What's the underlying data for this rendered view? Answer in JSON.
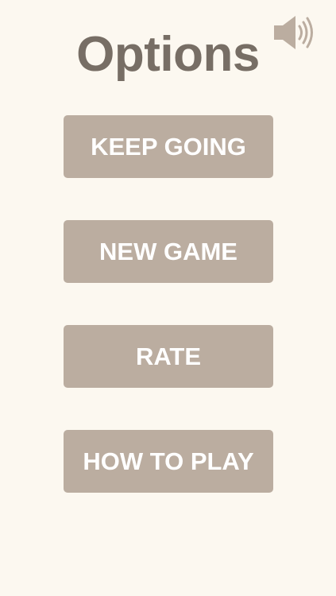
{
  "page": {
    "title": "Options"
  },
  "sound_toggle": {
    "icon": "speaker-volume-icon",
    "state": "on"
  },
  "menu": {
    "items": [
      {
        "label": "KEEP GOING"
      },
      {
        "label": "NEW GAME"
      },
      {
        "label": "RATE"
      },
      {
        "label": "HOW TO PLAY"
      }
    ]
  },
  "colors": {
    "background": "#fcf8f0",
    "title": "#776e65",
    "button": "#bbada0",
    "button_text": "#ffffff",
    "icon": "#bbada0"
  }
}
